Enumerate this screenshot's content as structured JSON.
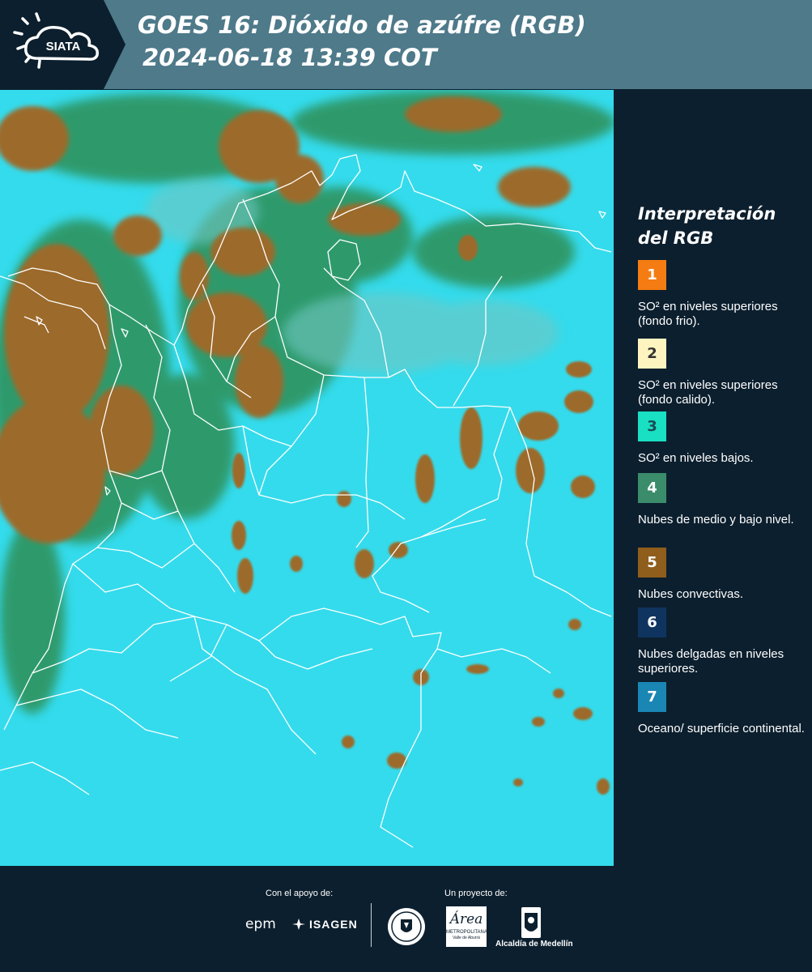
{
  "header": {
    "logo_text": "SIATA",
    "title_line1": "GOES 16: Dióxido de azúfre (RGB)",
    "title_line2": "2024-06-18 13:39 COT"
  },
  "map": {
    "colors": {
      "background": "#2fd8ea",
      "convective": "#9a6c2c",
      "mid_low": "#2f8c55",
      "outline": "#ffffff"
    }
  },
  "legend": {
    "title": "Interpretación del RGB",
    "items": [
      {
        "num": "1",
        "color": "#f57c12",
        "text_color": "#ffffff",
        "label": "SO² en niveles superiores (fondo frio)."
      },
      {
        "num": "2",
        "color": "#fdf4c0",
        "text_color": "#333333",
        "label": "SO² en niveles superiores (fondo calido)."
      },
      {
        "num": "3",
        "color": "#19dfc3",
        "text_color": "#1c4a55",
        "label": "SO² en niveles bajos."
      },
      {
        "num": "4",
        "color": "#3a8c6b",
        "text_color": "#ffffff",
        "label": "Nubes de medio y bajo nivel."
      },
      {
        "num": "5",
        "color": "#8f5d1c",
        "text_color": "#ffffff",
        "label": "Nubes convectivas."
      },
      {
        "num": "6",
        "color": "#0f3460",
        "text_color": "#ffffff",
        "label": "Nubes delgadas en niveles superiores."
      },
      {
        "num": "7",
        "color": "#1a86b4",
        "text_color": "#ffffff",
        "label": "Oceano/ superficie continental."
      }
    ]
  },
  "footer": {
    "support_label": "Con el apoyo de:",
    "project_label": "Un proyecto de:",
    "sponsors": [
      "epm",
      "ISAGEN"
    ],
    "partners": [
      "Área",
      "METROPOLITANA",
      "Valle de Aburrá",
      "Alcaldía de Medellín"
    ]
  }
}
